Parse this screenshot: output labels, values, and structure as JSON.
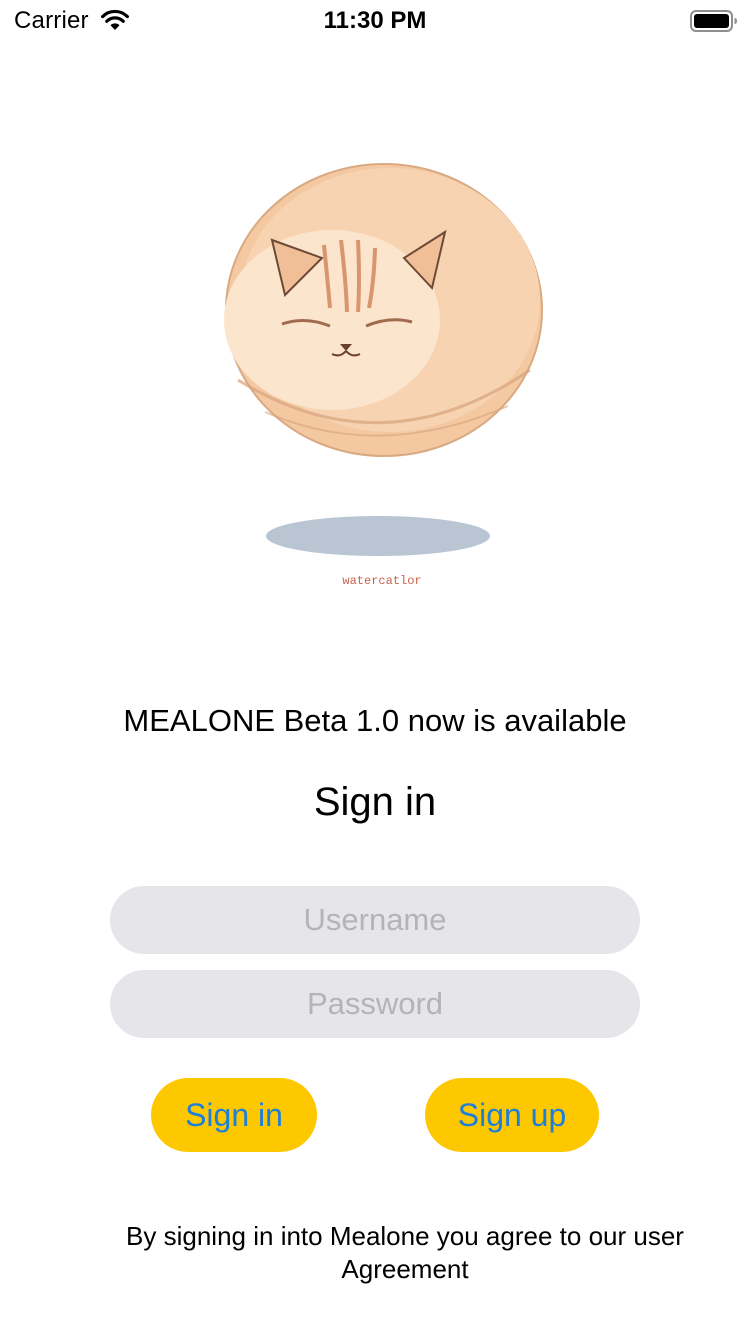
{
  "status_bar": {
    "carrier": "Carrier",
    "time": "11:30 PM",
    "icons": [
      "wifi-icon",
      "battery-icon"
    ]
  },
  "illustration": {
    "subject": "cat-illustration",
    "caption": "watercatlor",
    "colors": {
      "fur": "#f2c29a",
      "shadow": "#b9c5d3",
      "caption": "#c9624a"
    }
  },
  "headline": "MEALONE Beta 1.0 now is available",
  "signin_title": "Sign in",
  "form": {
    "username_placeholder": "Username",
    "password_placeholder": "Password"
  },
  "buttons": {
    "signin_label": "Sign in",
    "signup_label": "Sign up"
  },
  "agreement": "By signing in into Mealone you agree to our user Agreement",
  "colors": {
    "button_bg": "#fdc800",
    "button_text": "#1d7fd9",
    "field_bg": "#e5e5ea",
    "placeholder": "#b4b4b8"
  }
}
